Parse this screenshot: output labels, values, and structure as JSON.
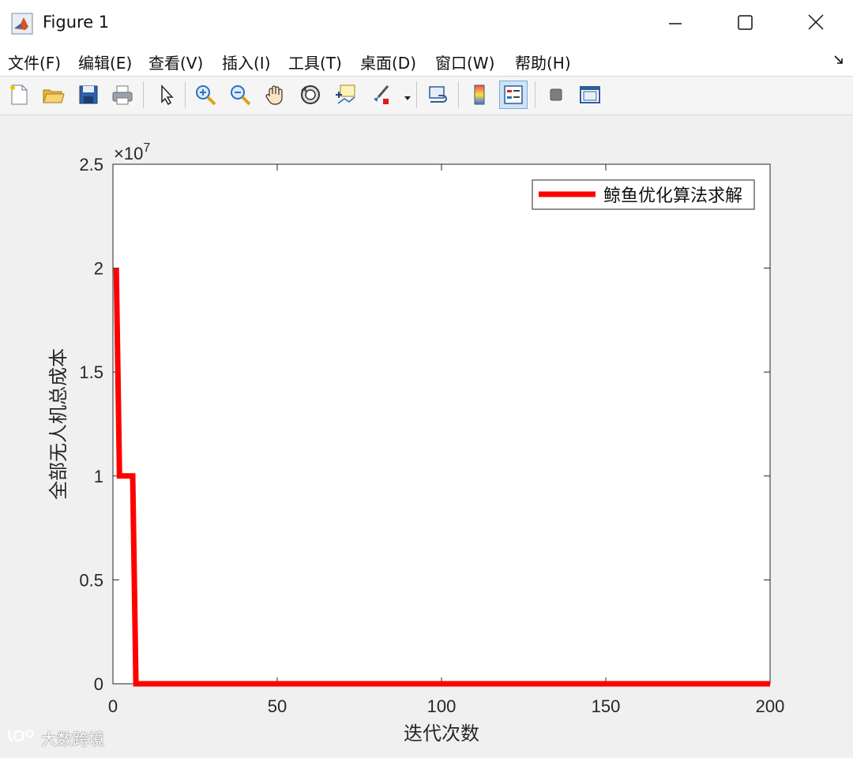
{
  "window": {
    "title": "Figure 1",
    "minimize_label": "minimize",
    "maximize_label": "maximize",
    "close_label": "close"
  },
  "menu": {
    "items": [
      {
        "label": "文件(F)"
      },
      {
        "label": "编辑(E)"
      },
      {
        "label": "查看(V)"
      },
      {
        "label": "插入(I)"
      },
      {
        "label": "工具(T)"
      },
      {
        "label": "桌面(D)"
      },
      {
        "label": "窗口(W)"
      },
      {
        "label": "帮助(H)"
      }
    ]
  },
  "toolbar": {
    "icons": [
      "new-figure-icon",
      "open-file-icon",
      "save-icon",
      "print-icon",
      "pointer-icon",
      "zoom-in-icon",
      "zoom-out-icon",
      "pan-icon",
      "rotate-3d-icon",
      "data-cursor-icon",
      "brush-icon",
      "link-plot-icon",
      "colorbar-icon",
      "legend-icon",
      "hide-plot-tools-icon",
      "show-plot-tools-icon"
    ]
  },
  "watermark": {
    "text": "大数跨境"
  },
  "chart_data": {
    "type": "line",
    "xlabel": "迭代次数",
    "ylabel": "全部无人机总成本",
    "exponent_label": "×10",
    "exponent_power": "7",
    "xlim": [
      0,
      200
    ],
    "ylim": [
      0,
      25000000
    ],
    "x_ticks": [
      0,
      50,
      100,
      150,
      200
    ],
    "x_tick_labels": [
      "0",
      "50",
      "100",
      "150",
      "200"
    ],
    "y_ticks": [
      0,
      5000000,
      10000000,
      15000000,
      20000000,
      25000000
    ],
    "y_tick_labels": [
      "0",
      "0.5",
      "1",
      "1.5",
      "2",
      "2.5"
    ],
    "grid": false,
    "legend_position": "top-right",
    "series": [
      {
        "name": "鲸鱼优化算法求解",
        "color": "#ff0000",
        "x": [
          1,
          2,
          3,
          4,
          5,
          6,
          7,
          200
        ],
        "y": [
          20000000,
          10000000,
          10000000,
          10000000,
          10000000,
          10000000,
          0,
          0
        ]
      }
    ]
  }
}
